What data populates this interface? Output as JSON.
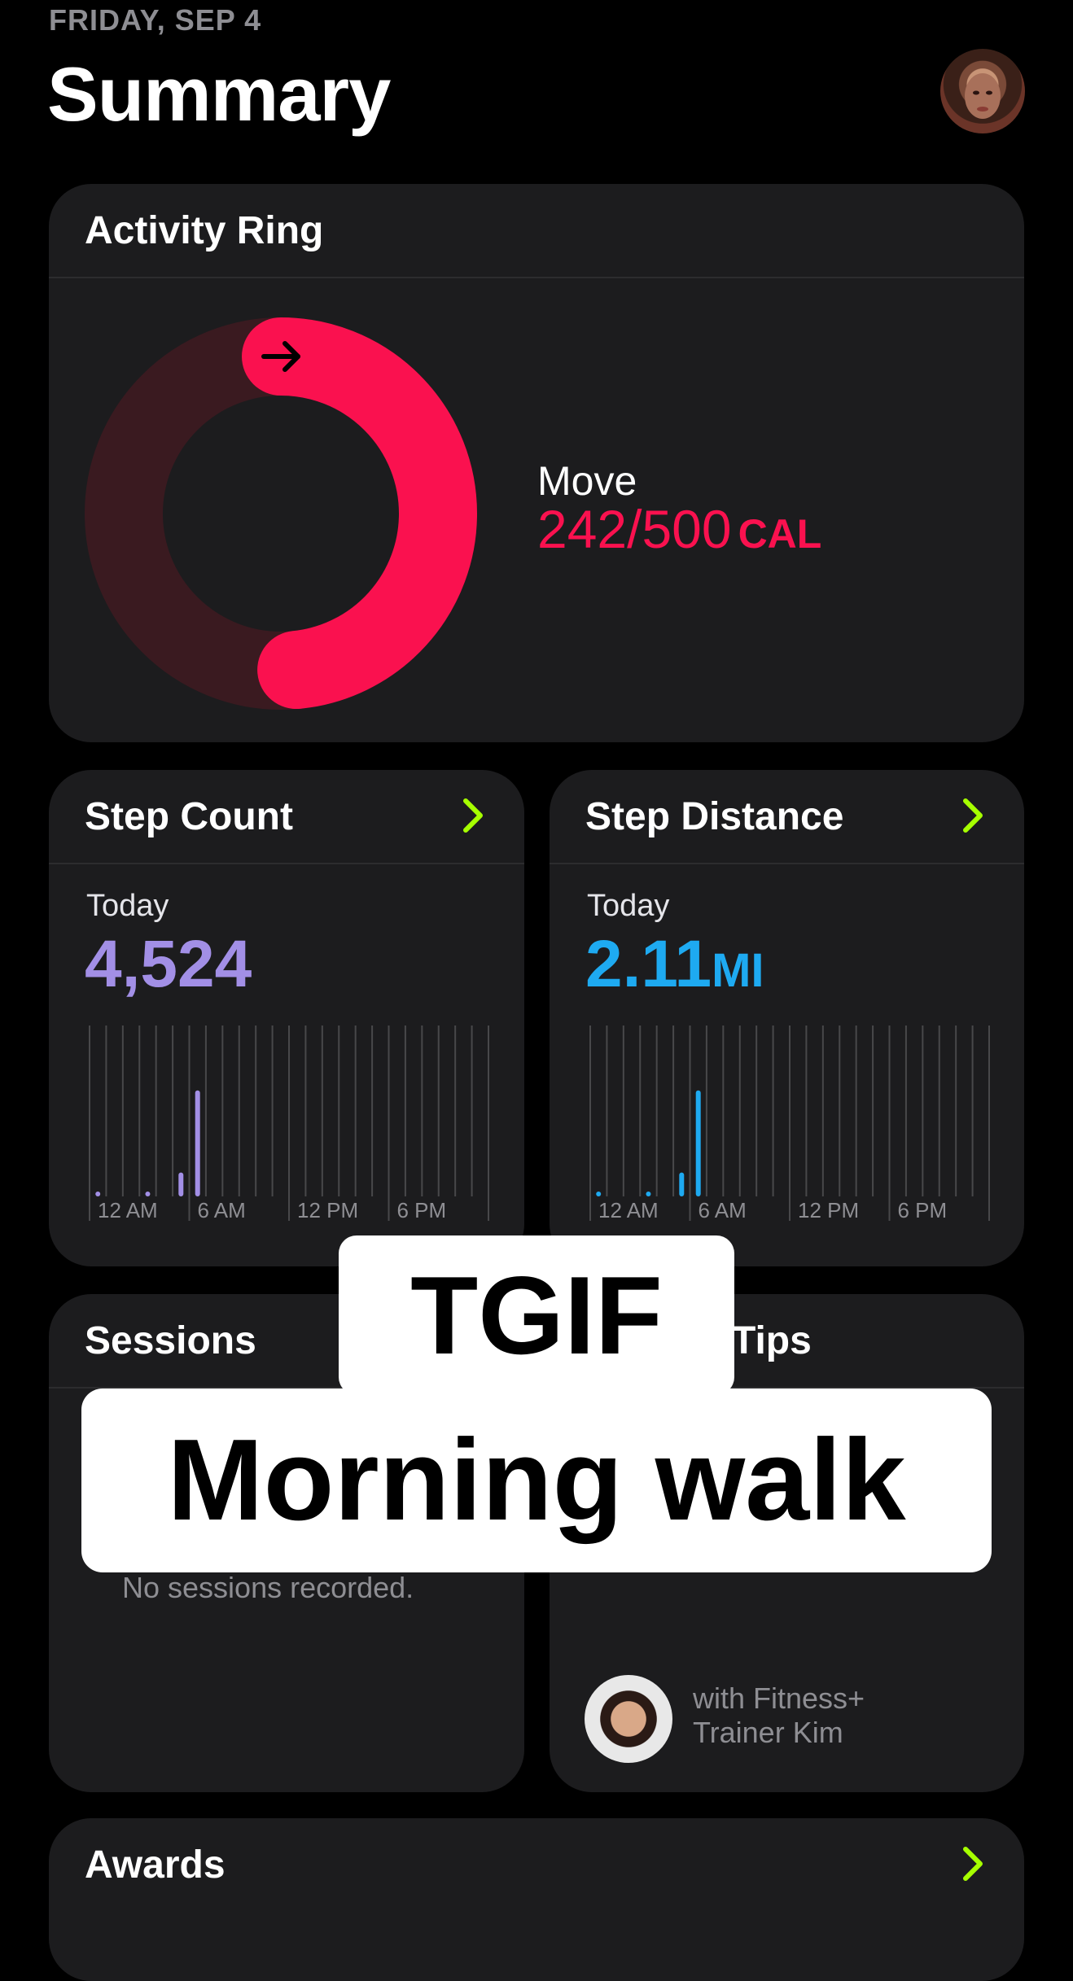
{
  "header": {
    "date": "FRIDAY, SEP 4",
    "title": "Summary"
  },
  "activity": {
    "title": "Activity Ring",
    "move_label": "Move",
    "move_value": "242/500",
    "move_unit": "CAL",
    "move_progress": 0.484,
    "ring_color": "#fa114f"
  },
  "steps": {
    "title": "Step Count",
    "today_label": "Today",
    "value": "4,524",
    "color": "#a28fe6",
    "x_labels": [
      "12 AM",
      "6 AM",
      "12 PM",
      "6 PM"
    ],
    "bars": [
      0.02,
      0,
      0,
      0.02,
      0,
      0.14,
      0.62,
      0,
      0,
      0,
      0,
      0,
      0,
      0,
      0,
      0,
      0,
      0,
      0,
      0,
      0,
      0,
      0,
      0
    ]
  },
  "distance": {
    "title": "Step Distance",
    "today_label": "Today",
    "value": "2.11",
    "unit": "MI",
    "color": "#1eaaf1",
    "x_labels": [
      "12 AM",
      "6 AM",
      "12 PM",
      "6 PM"
    ],
    "bars": [
      0.02,
      0,
      0,
      0.02,
      0,
      0.14,
      0.62,
      0,
      0,
      0,
      0,
      0,
      0,
      0,
      0,
      0,
      0,
      0,
      0,
      0,
      0,
      0,
      0,
      0
    ]
  },
  "sessions": {
    "title": "Sessions",
    "empty_text": "No sessions recorded."
  },
  "tips": {
    "title": "Tips",
    "subtitle_line1": "with Fitness+",
    "subtitle_line2": "Trainer Kim"
  },
  "awards": {
    "title": "Awards"
  },
  "overlay": {
    "caption_top": "TGIF",
    "caption_bottom": "Morning walk"
  },
  "colors": {
    "accent_green": "#a6ff00",
    "card_bg": "#1c1c1e"
  }
}
